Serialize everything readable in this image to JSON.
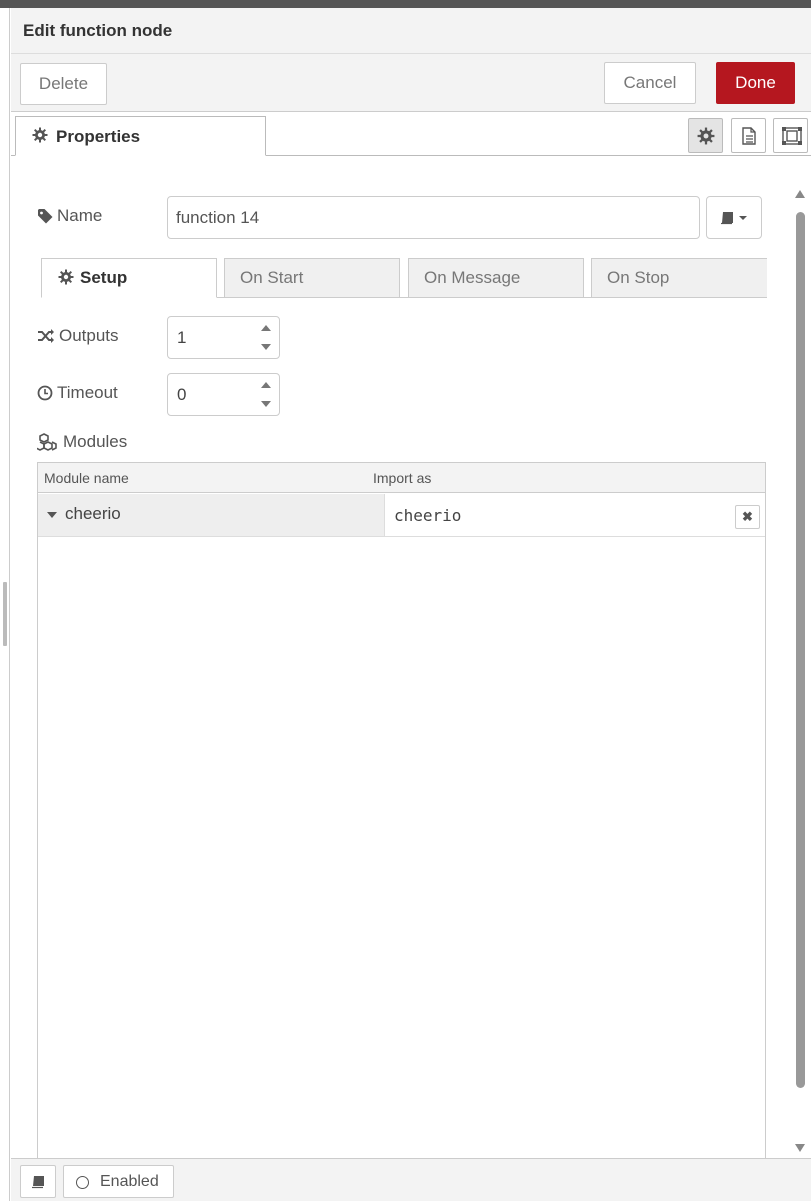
{
  "header": {
    "title": "Edit function node"
  },
  "toolbar": {
    "delete_label": "Delete",
    "cancel_label": "Cancel",
    "done_label": "Done"
  },
  "tabs": {
    "properties_label": "Properties"
  },
  "form": {
    "name_label": "Name",
    "name_value": "function 14",
    "inner_tabs": [
      "Setup",
      "On Start",
      "On Message",
      "On Stop"
    ],
    "outputs_label": "Outputs",
    "outputs_value": "1",
    "timeout_label": "Timeout",
    "timeout_value": "0",
    "modules_label": "Modules"
  },
  "modules_table": {
    "columns": [
      "Module name",
      "Import as"
    ],
    "rows": [
      {
        "module": "cheerio",
        "import_as": "cheerio"
      }
    ]
  },
  "footer": {
    "enabled_label": "Enabled"
  },
  "colors": {
    "accent": "#b5171f",
    "panel_bg": "#f3f3f3",
    "border": "#cccccc"
  }
}
